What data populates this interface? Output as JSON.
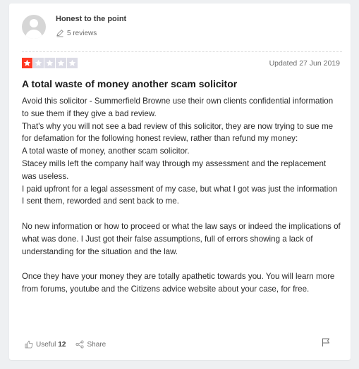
{
  "user": {
    "name": "Honest to the point",
    "review_count": "5 reviews"
  },
  "review": {
    "rating": 1,
    "max_rating": 5,
    "updated": "Updated 27 Jun 2019",
    "title": "A total waste of money another scam solicitor",
    "paragraphs": [
      "Avoid this solicitor - Summerfield Browne use their own clients confidential information to sue them if they give a bad review.",
      "That's why you will not see a bad review of this solicitor, they are now trying to sue me for defamation for the following honest review, rather than refund my money:",
      "A total waste of money, another scam solicitor.",
      "Stacey mills left the company half way through my assessment and the replacement was useless.",
      "I paid upfront for a legal assessment of my case, but what I got was just the information I sent them, reworded and sent back to me.",
      "",
      "No new information or how to proceed or what the law says or indeed the implications of what was done. I Just got their false assumptions, full of errors showing a lack of understanding for the situation and the law.",
      "",
      "Once they have your money they are totally apathetic towards you. You will learn more from forums, youtube and the Citizens advice website about your case, for free."
    ]
  },
  "actions": {
    "useful_label": "Useful",
    "useful_count": "12",
    "share_label": "Share"
  },
  "colors": {
    "star_filled": "#ff3722",
    "star_empty": "#dcdce6"
  },
  "icons": {
    "avatar": "user-avatar-icon",
    "pencil": "pencil-icon",
    "star": "star-icon",
    "thumb": "thumbs-up-icon",
    "share": "share-icon",
    "flag": "flag-icon"
  }
}
